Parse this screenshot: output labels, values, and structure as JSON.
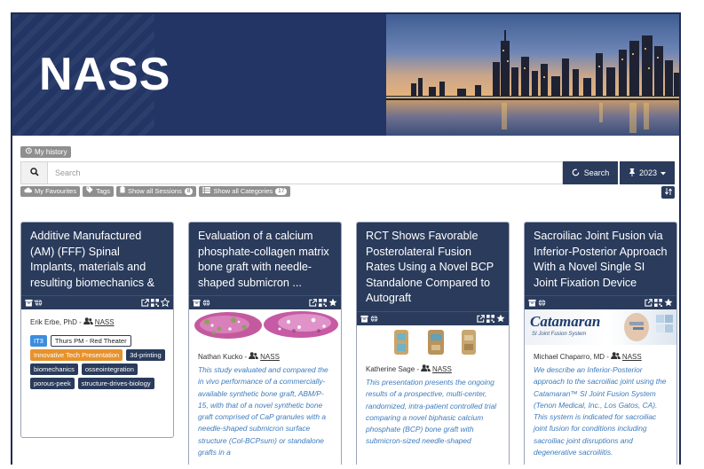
{
  "banner": {
    "logo": "NASS"
  },
  "toolbar": {
    "history_label": "My history",
    "search_placeholder": "Search",
    "search_label": "Search",
    "year_label": "2023"
  },
  "filters": {
    "favourites": "My Favourites",
    "tags": "Tags",
    "sessions": "Show all Sessions",
    "sessions_count": "8",
    "categories": "Show all Categories",
    "categories_count": "17"
  },
  "cards": [
    {
      "title": "Additive Manufactured (AM) (FFF) Spinal Implants, materials and resulting biomechanics & ...",
      "author": "Erik Erbe, PhD -",
      "org": "NASS",
      "tags": [
        "IT3",
        "Thurs PM - Red Theater",
        "Innovative Tech Presentation",
        "3d-printing",
        "biomechanics",
        "osseointegration",
        "porous-peek",
        "structure-drives-biology"
      ]
    },
    {
      "title": "Evaluation of a calcium phosphate-collagen matrix bone graft with needle-shaped submicron ...",
      "author": "Nathan Kucko -",
      "org": "NASS",
      "abstract": "This study evaluated and compared the in vivo performance of a commercially-available synthetic bone graft, ABM/P-15, with that of a novel synthetic bone graft comprised of CaP granules with a needle-shaped submicron surface structure (Col-BCPsum) or standalone grafts in a"
    },
    {
      "title": "RCT Shows Favorable Posterolateral Fusion Rates Using a Novel BCP Standalone Compared to Autograft",
      "author": "Katherine Sage -",
      "org": "NASS",
      "abstract": "This presentation presents the ongoing results of a prospective, multi-center, randomized, intra-patient controlled trial comparing a novel biphasic calcium phosphate (BCP) bone graft with submicron-sized needle-shaped"
    },
    {
      "title": "Sacroiliac Joint Fusion via Inferior-Posterior Approach With a Novel Single SI Joint Fixation Device",
      "author": "Michael Chaparro, MD -",
      "org": "NASS",
      "image_title": "Catamaran",
      "image_subtitle": "SI Joint Fusion System",
      "abstract": "We describe an Inferior-Posterior approach to the sacroiliac joint using the Catamaran™ SI Joint Fusion System (Tenon Medical, Inc., Los Gatos, CA). This system is indicated for sacroiliac joint fusion for conditions including sacroiliac joint disruptions and degenerative sacroiliitis."
    }
  ],
  "colors": {
    "navy": "#2a3b5c",
    "banner": "#233564",
    "link": "#3d7bbd",
    "orange": "#e8922b",
    "blue_tag": "#3c8dde"
  }
}
